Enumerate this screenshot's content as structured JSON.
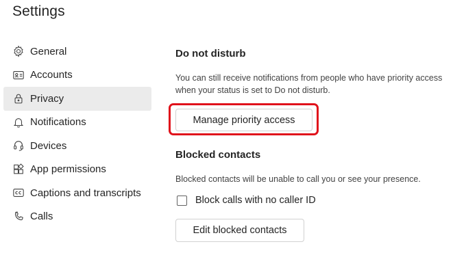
{
  "page": {
    "title": "Settings"
  },
  "sidebar": {
    "items": [
      {
        "label": "General",
        "icon": "gear-icon"
      },
      {
        "label": "Accounts",
        "icon": "id-card-icon"
      },
      {
        "label": "Privacy",
        "icon": "lock-icon",
        "active": true
      },
      {
        "label": "Notifications",
        "icon": "bell-icon"
      },
      {
        "label": "Devices",
        "icon": "headset-icon"
      },
      {
        "label": "App permissions",
        "icon": "grid-icon"
      },
      {
        "label": "Captions and transcripts",
        "icon": "cc-icon"
      },
      {
        "label": "Calls",
        "icon": "phone-icon"
      }
    ]
  },
  "dnd": {
    "heading": "Do not disturb",
    "description": "You can still receive notifications from people who have priority access when your status is set to Do not disturb.",
    "manage_button": "Manage priority access"
  },
  "blocked": {
    "heading": "Blocked contacts",
    "description": "Blocked contacts will be unable to call you or see your presence.",
    "checkbox_label": "Block calls with no caller ID",
    "checkbox_checked": false,
    "edit_button": "Edit blocked contacts"
  },
  "colors": {
    "highlight": "#e0121b",
    "active_nav_bg": "#ebebeb"
  }
}
